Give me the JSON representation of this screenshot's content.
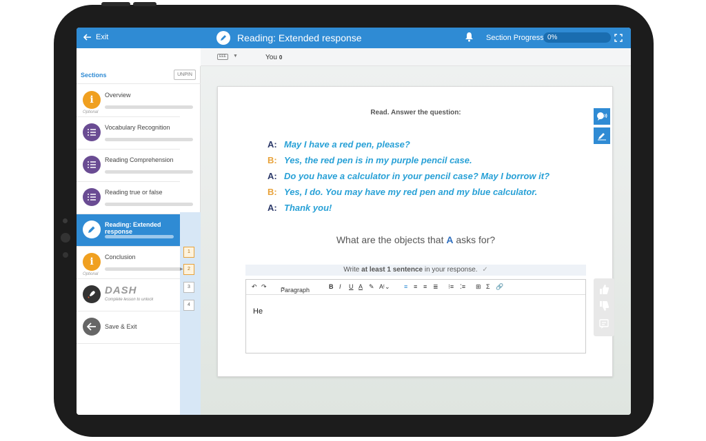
{
  "topbar": {
    "exit_label": "Exit",
    "title": "Reading: Extended response",
    "progress_label": "Section Progress:",
    "progress_value": "0%",
    "progress_fraction": 0
  },
  "subbar": {
    "keyboard_label": "EEE",
    "user_label": "You",
    "user_count": "0"
  },
  "sidebar": {
    "heading": "Sections",
    "unpin_label": "UNPIN",
    "sections": [
      {
        "name": "Overview",
        "icon": "info-icon",
        "optional": "Optional",
        "color": "#f0a020"
      },
      {
        "name": "Vocabulary Recognition",
        "icon": "checklist-icon",
        "color": "#6a4c93"
      },
      {
        "name": "Reading Comprehension",
        "icon": "checklist-icon",
        "color": "#6a4c93"
      },
      {
        "name": "Reading true or false",
        "icon": "checklist-icon",
        "color": "#6a4c93"
      },
      {
        "name": "Reading: Extended response",
        "icon": "pencil-icon",
        "color": "#2f8bd4",
        "active": true
      },
      {
        "name": "Conclusion",
        "icon": "info-icon",
        "optional": "Optional",
        "color": "#f0a020"
      },
      {
        "name": "DASH",
        "icon": "rocket-icon",
        "sub": "Complete lesson to unlock"
      },
      {
        "name": "Save & Exit",
        "icon": "arrow-left-icon"
      }
    ],
    "pages": [
      "1",
      "2",
      "3",
      "4"
    ]
  },
  "activity": {
    "instruction": "Read. Answer the question:",
    "dialogue": [
      {
        "speaker": "A:",
        "text": "May I have a red pen, please?"
      },
      {
        "speaker": "B:",
        "text": "Yes, the red pen is in my purple pencil case."
      },
      {
        "speaker": "A:",
        "text": "Do you have a calculator in your pencil case? May I borrow it?"
      },
      {
        "speaker": "B:",
        "text": "Yes, I do. You may have my red pen and my blue calculator."
      },
      {
        "speaker": "A:",
        "text": "Thank you!"
      }
    ],
    "question_pre": "What are the objects that",
    "question_speaker": "A",
    "question_post": "asks for?",
    "hint_pre": "Write",
    "hint_bold": "at least 1 sentence",
    "hint_post": "in your response.",
    "editor_text": "He",
    "toolbar_paragraph": "Paragraph"
  },
  "colors": {
    "brand": "#2f8bd4",
    "speaker_a": "#2d3a6a",
    "speaker_b": "#e8a23a",
    "dialogue": "#27a0d6"
  }
}
